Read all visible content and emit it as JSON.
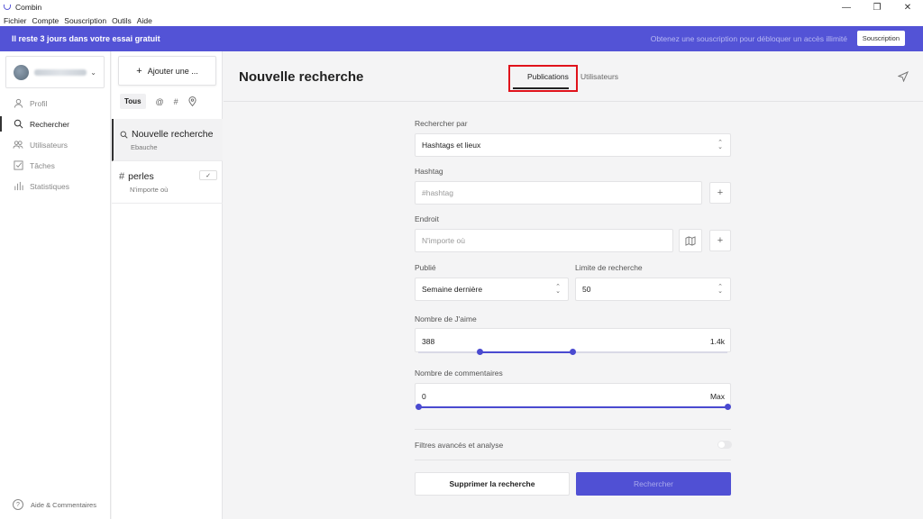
{
  "window": {
    "title": "Combin",
    "controls": {
      "minimize": "—",
      "maximize": "❐",
      "close": "✕"
    }
  },
  "menu": [
    "Fichier",
    "Compte",
    "Souscription",
    "Outils",
    "Aide"
  ],
  "banner": {
    "message": "Il reste 3 jours dans votre essai gratuit",
    "promo": "Obtenez une souscription pour débloquer un accès illimité",
    "button": "Souscription"
  },
  "sidebar": {
    "items": [
      {
        "label": "Profil",
        "icon": "user-icon",
        "active": false
      },
      {
        "label": "Rechercher",
        "icon": "search-icon",
        "active": true
      },
      {
        "label": "Utilisateurs",
        "icon": "users-icon",
        "active": false
      },
      {
        "label": "Tâches",
        "icon": "tasks-icon",
        "active": false
      },
      {
        "label": "Statistiques",
        "icon": "stats-icon",
        "active": false
      }
    ],
    "help": "Aide & Commentaires"
  },
  "searches": {
    "add_label": "Ajouter une ...",
    "filters": {
      "all": "Tous",
      "mention": "@",
      "hashtag": "#"
    },
    "items": [
      {
        "title": "Nouvelle recherche",
        "subtitle": "Ebauche",
        "icon": "search-icon",
        "active": true
      },
      {
        "title": "perles",
        "subtitle": "N'importe où",
        "icon": "hash-icon",
        "checked": "✓"
      }
    ]
  },
  "main": {
    "title": "Nouvelle recherche",
    "tabs": {
      "publications": "Publications",
      "users": "Utilisateurs"
    },
    "form": {
      "search_by_label": "Rechercher par",
      "search_by_value": "Hashtags et lieux",
      "hashtag_label": "Hashtag",
      "hashtag_placeholder": "#hashtag",
      "place_label": "Endroit",
      "place_placeholder": "N'importe où",
      "published_label": "Publié",
      "published_value": "Semaine dernière",
      "limit_label": "Limite de recherche",
      "limit_value": "50",
      "likes_label": "Nombre de J'aime",
      "likes_min": "388",
      "likes_max": "1.4k",
      "likes_range_fraction": [
        0.2,
        0.5
      ],
      "comments_label": "Nombre de commentaires",
      "comments_min": "0",
      "comments_max": "Max",
      "comments_range_fraction": [
        0.0,
        1.0
      ],
      "advanced_label": "Filtres avancés et analyse",
      "delete_button": "Supprimer la recherche",
      "search_button": "Rechercher"
    }
  },
  "colors": {
    "accent": "#5353d6",
    "highlight": "#e0121b"
  }
}
